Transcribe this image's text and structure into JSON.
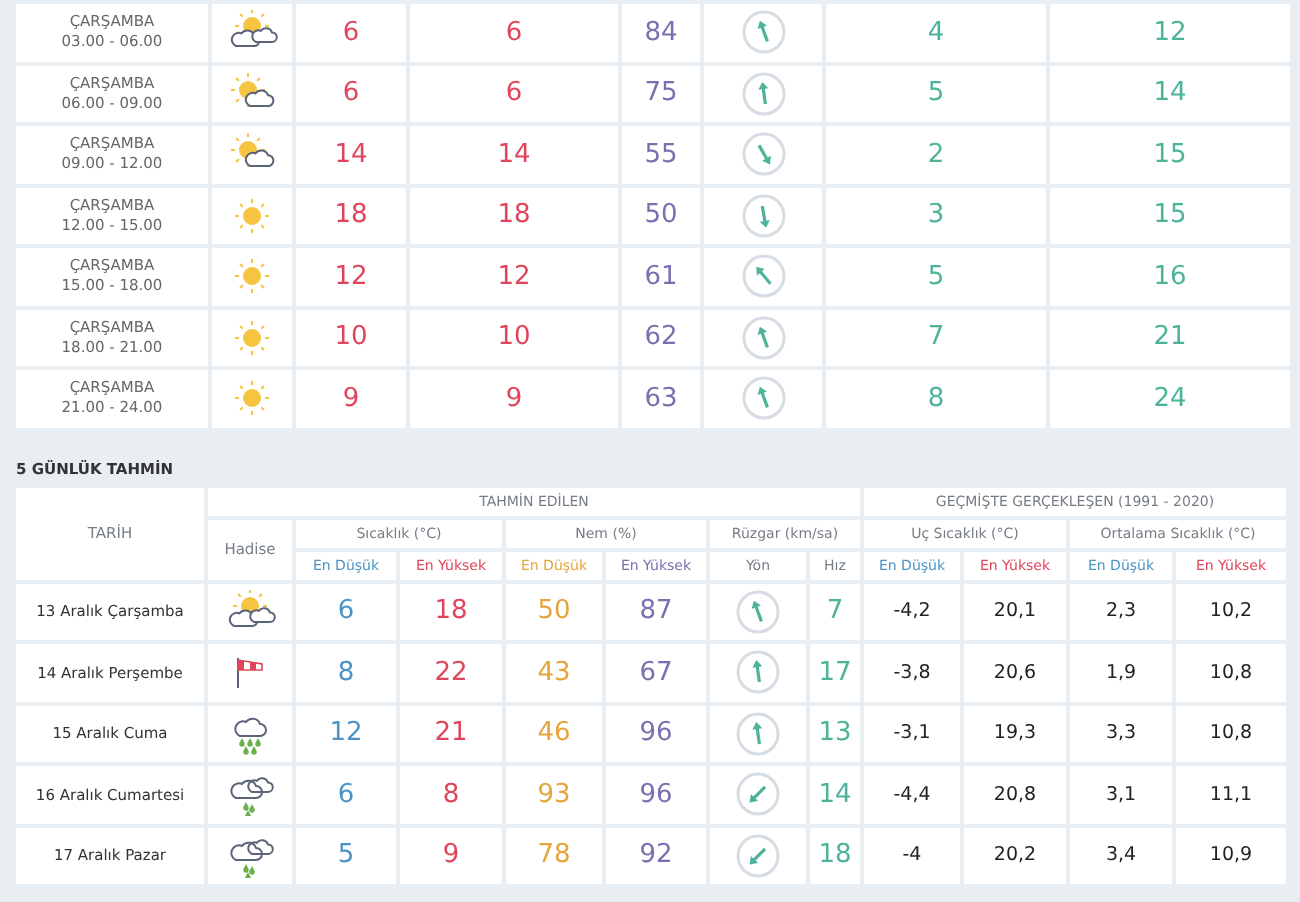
{
  "hourly_table": {
    "rows": [
      {
        "day": "ÇARŞAMBA",
        "time": "03.00 - 06.00",
        "weather_icon": {
          "kind": "sun_clouds"
        },
        "column_3": "6",
        "column_4": "6",
        "column_5": "84",
        "wind_icon": {
          "kind": "nnw"
        },
        "column_7": "4",
        "column_8": "12"
      },
      {
        "day": "ÇARŞAMBA",
        "time": "06.00 - 09.00",
        "weather_icon": {
          "kind": "sun_cloud"
        },
        "column_3": "6",
        "column_4": "6",
        "column_5": "75",
        "wind_icon": {
          "kind": "n"
        },
        "column_7": "5",
        "column_8": "14"
      },
      {
        "day": "ÇARŞAMBA",
        "time": "09.00 - 12.00",
        "weather_icon": {
          "kind": "sun_cloud"
        },
        "column_3": "14",
        "column_4": "14",
        "column_5": "55",
        "wind_icon": {
          "kind": "sse"
        },
        "column_7": "2",
        "column_8": "15"
      },
      {
        "day": "ÇARŞAMBA",
        "time": "12.00 - 15.00",
        "weather_icon": {
          "kind": "sun"
        },
        "column_3": "18",
        "column_4": "18",
        "column_5": "50",
        "wind_icon": {
          "kind": "s"
        },
        "column_7": "3",
        "column_8": "15"
      },
      {
        "day": "ÇARŞAMBA",
        "time": "15.00 - 18.00",
        "weather_icon": {
          "kind": "sun"
        },
        "column_3": "12",
        "column_4": "12",
        "column_5": "61",
        "wind_icon": {
          "kind": "nw"
        },
        "column_7": "5",
        "column_8": "16"
      },
      {
        "day": "ÇARŞAMBA",
        "time": "18.00 - 21.00",
        "weather_icon": {
          "kind": "sun"
        },
        "column_3": "10",
        "column_4": "10",
        "column_5": "62",
        "wind_icon": {
          "kind": "nnw"
        },
        "column_7": "7",
        "column_8": "21"
      },
      {
        "day": "ÇARŞAMBA",
        "time": "21.00 - 24.00",
        "weather_icon": {
          "kind": "sun"
        },
        "column_3": "9",
        "column_4": "9",
        "column_5": "63",
        "wind_icon": {
          "kind": "nnw"
        },
        "column_7": "8",
        "column_8": "24"
      }
    ]
  },
  "five_day": {
    "title": "5 GÜNLÜK TAHMİN",
    "date_header": "TARİH",
    "forecast_header": "TAHMİN EDİLEN",
    "history_header": "GEÇMİŞTE GERÇEKLEŞEN (1991 - 2020)",
    "event_header": "Hadise",
    "groups": [
      "Sıcaklık (°C)",
      "Nem (%)",
      "Rüzgar (km/sa)",
      "Uç Sıcaklık (°C)",
      "Ortalama Sıcaklık (°C)"
    ],
    "subheaders": [
      {
        "label": "En Düşük",
        "color": "#4a93c4"
      },
      {
        "label": "En Yüksek",
        "color": "#e0455c"
      },
      {
        "label": "En Düşük",
        "color": "#e6a53a"
      },
      {
        "label": "En Yüksek",
        "color": "#7b6fb0"
      },
      {
        "label": "Yön",
        "color": "#777d86"
      },
      {
        "label": "Hız",
        "color": "#777d86"
      },
      {
        "label": "En Düşük",
        "color": "#4a93c4"
      },
      {
        "label": "En Yüksek",
        "color": "#e0455c"
      },
      {
        "label": "En Düşük",
        "color": "#4a93c4"
      },
      {
        "label": "En Yüksek",
        "color": "#e0455c"
      }
    ],
    "rows": [
      {
        "date": "13 Aralık Çarşamba",
        "weather_icon": {
          "kind": "sun_clouds"
        },
        "temp_low": "6",
        "temp_high": "18",
        "humidity_low": "50",
        "humidity_high": "87",
        "wind_icon": {
          "kind": "nnw"
        },
        "wind_speed": "7",
        "extreme_low": "-4,2",
        "extreme_high": "20,1",
        "avg_low": "2,3",
        "avg_high": "10,2"
      },
      {
        "date": "14 Aralık Perşembe",
        "weather_icon": {
          "kind": "wind"
        },
        "temp_low": "8",
        "temp_high": "22",
        "humidity_low": "43",
        "humidity_high": "67",
        "wind_icon": {
          "kind": "n"
        },
        "wind_speed": "17",
        "extreme_low": "-3,8",
        "extreme_high": "20,6",
        "avg_low": "1,9",
        "avg_high": "10,8"
      },
      {
        "date": "15 Aralık Cuma",
        "weather_icon": {
          "kind": "heavy_rain"
        },
        "temp_low": "12",
        "temp_high": "21",
        "humidity_low": "46",
        "humidity_high": "96",
        "wind_icon": {
          "kind": "n"
        },
        "wind_speed": "13",
        "extreme_low": "-3,1",
        "extreme_high": "19,3",
        "avg_low": "3,3",
        "avg_high": "10,8"
      },
      {
        "date": "16 Aralık Cumartesi",
        "weather_icon": {
          "kind": "rain"
        },
        "temp_low": "6",
        "temp_high": "8",
        "humidity_low": "93",
        "humidity_high": "96",
        "wind_icon": {
          "kind": "sw"
        },
        "wind_speed": "14",
        "extreme_low": "-4,4",
        "extreme_high": "20,8",
        "avg_low": "3,1",
        "avg_high": "11,1"
      },
      {
        "date": "17 Aralık Pazar",
        "weather_icon": {
          "kind": "rain"
        },
        "temp_low": "5",
        "temp_high": "9",
        "humidity_low": "78",
        "humidity_high": "92",
        "wind_icon": {
          "kind": "sw"
        },
        "wind_speed": "18",
        "extreme_low": "-4",
        "extreme_high": "20,2",
        "avg_low": "3,4",
        "avg_high": "10,9"
      }
    ]
  }
}
